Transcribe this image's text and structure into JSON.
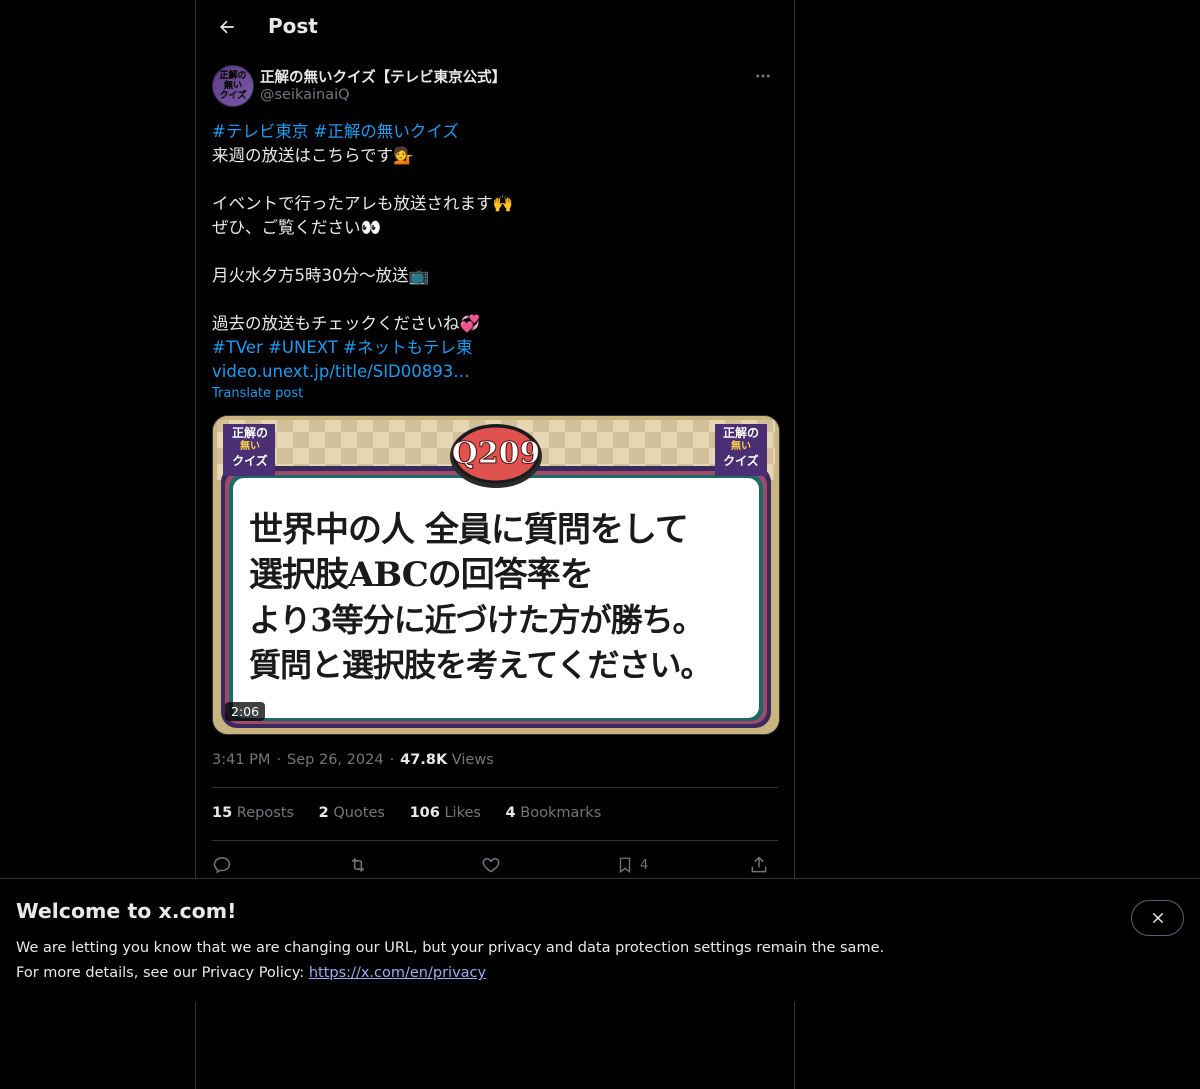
{
  "header": {
    "back_icon": "arrow-left-icon",
    "title": "Post"
  },
  "author": {
    "display_name": "正解の無いクイズ【テレビ東京公式】",
    "handle": "@seikainaiQ",
    "avatar_text": [
      "正解の",
      "無い",
      "クイズ"
    ],
    "more_icon": "more-horizontal-icon"
  },
  "post": {
    "hashtags_line1": [
      "#テレビ東京",
      "#正解の無いクイズ"
    ],
    "line2": "来週の放送はこちらです💁",
    "line4": "イベントで行ったアレも放送されます🙌",
    "line5": "ぜひ、ご覧ください👀",
    "line7": "月火水夕方5時30分〜放送📺",
    "line9": "過去の放送もチェックくださいね💞",
    "hashtags_line10": [
      "#TVer",
      "#UNEXT",
      "#ネットもテレ東"
    ],
    "url": "video.unext.jp/title/SID00893…",
    "translate": "Translate post"
  },
  "media": {
    "question_number": "Q209",
    "logo_left": [
      "正解の",
      "無い",
      "クイズ"
    ],
    "logo_right": [
      "正解の",
      "無い",
      "クイズ"
    ],
    "question_lines": [
      "世界中の人 全員に質問をして",
      "選択肢ABCの回答率を",
      "より3等分に近づけた方が勝ち。",
      "質問と選択肢を考えてください。"
    ],
    "duration": "2:06"
  },
  "meta": {
    "time": "3:41 PM",
    "date": "Sep 26, 2024",
    "views_count": "47.8K",
    "views_label": "Views"
  },
  "stats": {
    "reposts_count": "15",
    "reposts_label": "Reposts",
    "quotes_count": "2",
    "quotes_label": "Quotes",
    "likes_count": "106",
    "likes_label": "Likes",
    "bookmarks_count": "4",
    "bookmarks_label": "Bookmarks"
  },
  "actions": {
    "reply_icon": "reply-icon",
    "repost_icon": "repost-icon",
    "like_icon": "heart-icon",
    "bookmark_icon": "bookmark-icon",
    "bookmark_count": "4",
    "share_icon": "share-icon"
  },
  "banner": {
    "title": "Welcome to x.com!",
    "line1": "We are letting you know that we are changing our URL, but your privacy and data protection settings remain the same.",
    "line2_prefix": "For more details, see our Privacy Policy: ",
    "link": "https://x.com/en/privacy",
    "close_icon": "close-icon"
  },
  "colors": {
    "background": "#000000",
    "text": "#e7e9ea",
    "muted": "#71767b",
    "link": "#1d9bf0",
    "border": "#2f3336",
    "banner_link": "#a5a8f0"
  }
}
